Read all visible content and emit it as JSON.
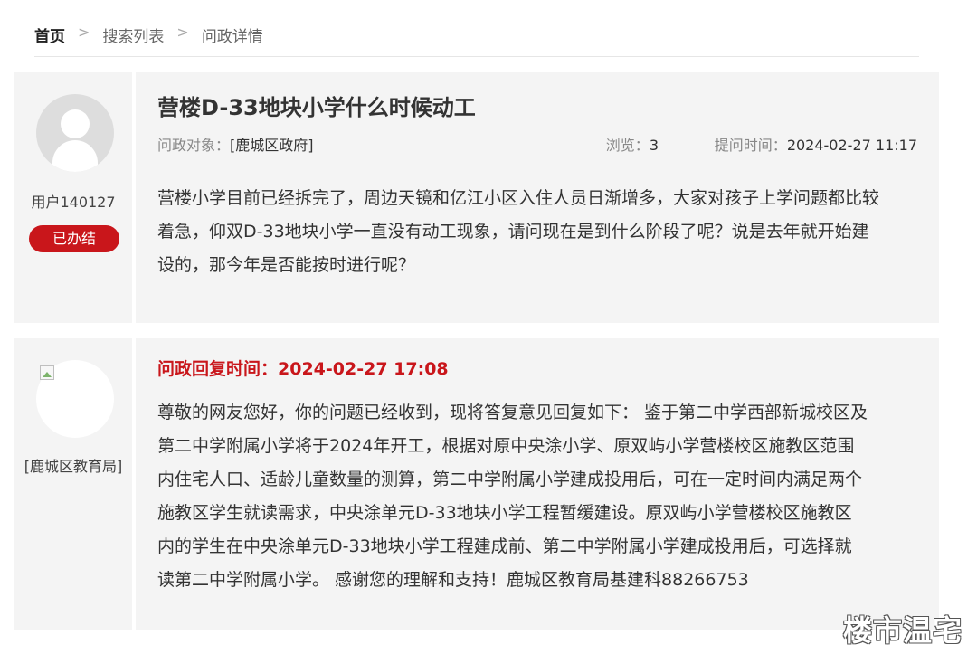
{
  "breadcrumb": {
    "items": [
      "首页",
      "搜索列表",
      "问政详情"
    ],
    "separator": ">"
  },
  "question": {
    "user_name": "用户140127",
    "status_badge": "已办结",
    "title": "营楼D-33地块小学什么时候动工",
    "target_label": "问政对象：",
    "target_value": "[鹿城区政府]",
    "views_label": "浏览：",
    "views_value": "3",
    "time_label": "提问时间：",
    "time_value": "2024-02-27 11:17",
    "content": "营楼小学目前已经拆完了，周边天镜和亿江小区入住人员日渐增多，大家对孩子上学问题都比较着急，仰双D-33地块小学一直没有动工现象，请问现在是到什么阶段了呢？说是去年就开始建设的，那今年是否能按时进行呢？"
  },
  "reply": {
    "dept_name": "[鹿城区教育局]",
    "time_label": "问政回复时间：",
    "time_value": "2024-02-27 17:08",
    "content": "尊敬的网友您好，你的问题已经收到，现将答复意见回复如下：  鉴于第二中学西部新城校区及第二中学附属小学将于2024年开工，根据对原中央涂小学、原双屿小学营楼校区施教区范围内住宅人口、适龄儿童数量的测算，第二中学附属小学建成投用后，可在一定时间内满足两个施教区学生就读需求，中央涂单元D-33地块小学工程暂缓建设。原双屿小学营楼校区施教区内的学生在中央涂单元D-33地块小学工程建成前、第二中学附属小学建成投用后，可选择就读第二中学附属小学。 感谢您的理解和支持！鹿城区教育局基建科88266753"
  },
  "watermark": "楼市温宅",
  "colors": {
    "accent_red": "#c9161b",
    "card_bg": "#f4f4f4",
    "text": "#333333"
  }
}
